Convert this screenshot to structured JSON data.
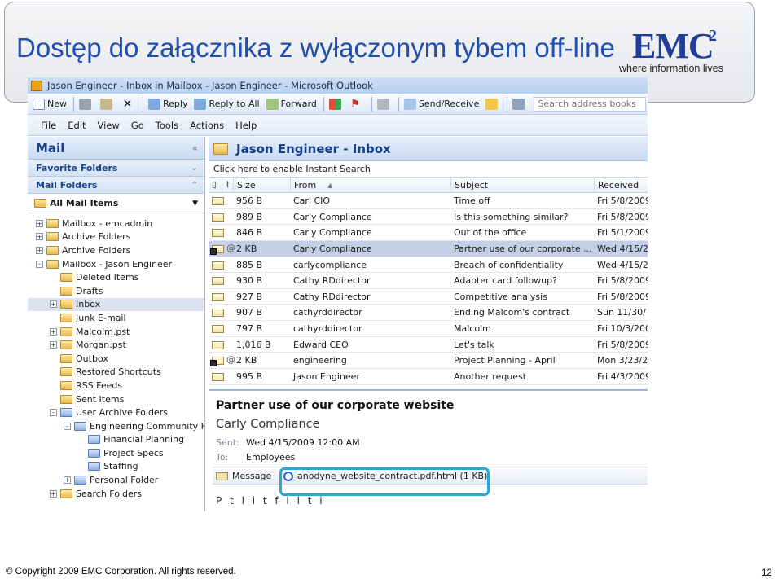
{
  "slide": {
    "title": "Dostęp do załącznika z wyłączonym tybem off-line",
    "logo_text": "EMC",
    "logo_sup": "2",
    "tagline": "where information lives",
    "copyright": "© Copyright 2009 EMC Corporation. All rights reserved.",
    "page_number": "12"
  },
  "window": {
    "title": "Jason Engineer - Inbox in Mailbox - Jason Engineer - Microsoft Outlook"
  },
  "toolbar": {
    "new": "New",
    "reply": "Reply",
    "reply_all": "Reply to All",
    "forward": "Forward",
    "send_receive": "Send/Receive",
    "search_placeholder": "Search address books"
  },
  "menu": [
    "File",
    "Edit",
    "View",
    "Go",
    "Tools",
    "Actions",
    "Help"
  ],
  "nav": {
    "title": "Mail",
    "favorite_folders": "Favorite Folders",
    "mail_folders": "Mail Folders",
    "all_mail_items": "All Mail Items",
    "tree": [
      {
        "label": "Mailbox - emcadmin",
        "indent": 0,
        "exp": "+",
        "icon": "mailbox"
      },
      {
        "label": "Archive Folders",
        "indent": 0,
        "exp": "+",
        "icon": "folder"
      },
      {
        "label": "Archive Folders",
        "indent": 0,
        "exp": "+",
        "icon": "folder"
      },
      {
        "label": "Mailbox - Jason Engineer",
        "indent": 0,
        "exp": "-",
        "icon": "mailbox"
      },
      {
        "label": "Deleted Items",
        "indent": 1,
        "exp": "",
        "icon": "folder"
      },
      {
        "label": "Drafts",
        "indent": 1,
        "exp": "",
        "icon": "folder"
      },
      {
        "label": "Inbox",
        "indent": 1,
        "exp": "+",
        "icon": "folder",
        "selected": true
      },
      {
        "label": "Junk E-mail",
        "indent": 1,
        "exp": "",
        "icon": "folder"
      },
      {
        "label": "Malcolm.pst",
        "indent": 1,
        "exp": "+",
        "icon": "folder"
      },
      {
        "label": "Morgan.pst",
        "indent": 1,
        "exp": "+",
        "icon": "folder"
      },
      {
        "label": "Outbox",
        "indent": 1,
        "exp": "",
        "icon": "folder"
      },
      {
        "label": "Restored Shortcuts",
        "indent": 1,
        "exp": "",
        "icon": "folder"
      },
      {
        "label": "RSS Feeds",
        "indent": 1,
        "exp": "",
        "icon": "folder"
      },
      {
        "label": "Sent Items",
        "indent": 1,
        "exp": "",
        "icon": "folder"
      },
      {
        "label": "User Archive Folders",
        "indent": 1,
        "exp": "-",
        "icon": "folder-blue"
      },
      {
        "label": "Engineering Community F",
        "indent": 2,
        "exp": "-",
        "icon": "folder-blue"
      },
      {
        "label": "Financial Planning",
        "indent": 3,
        "exp": "",
        "icon": "folder-blue"
      },
      {
        "label": "Project Specs",
        "indent": 3,
        "exp": "",
        "icon": "folder-blue"
      },
      {
        "label": "Staffing",
        "indent": 3,
        "exp": "",
        "icon": "folder-blue"
      },
      {
        "label": "Personal Folder",
        "indent": 2,
        "exp": "+",
        "icon": "folder-blue"
      },
      {
        "label": "Search Folders",
        "indent": 1,
        "exp": "+",
        "icon": "folder"
      }
    ]
  },
  "inbox": {
    "title": "Jason Engineer - Inbox",
    "instant_search": "Click here to enable Instant Search",
    "columns": {
      "size": "Size",
      "from": "From",
      "subject": "Subject",
      "received": "Received"
    },
    "rows": [
      {
        "size": "956 B",
        "from": "Carl CIO",
        "subject": "Time off",
        "received": "Fri 5/8/2009",
        "attach": false
      },
      {
        "size": "989 B",
        "from": "Carly Compliance",
        "subject": "Is this something similar?",
        "received": "Fri 5/8/2009",
        "attach": false
      },
      {
        "size": "846 B",
        "from": "Carly Compliance",
        "subject": "Out of the office",
        "received": "Fri 5/1/2009",
        "attach": false
      },
      {
        "size": "2 KB",
        "from": "Carly Compliance",
        "subject": "Partner use of our corporate ...",
        "received": "Wed 4/15/2",
        "attach": true,
        "selected": true
      },
      {
        "size": "885 B",
        "from": "carlycompliance",
        "subject": "Breach of confidentiality",
        "received": "Wed 4/15/2",
        "attach": false
      },
      {
        "size": "930 B",
        "from": "Cathy RDdirector",
        "subject": "Adapter card followup?",
        "received": "Fri 5/8/2009",
        "attach": false
      },
      {
        "size": "927 B",
        "from": "Cathy RDdirector",
        "subject": "Competitive analysis",
        "received": "Fri 5/8/2009",
        "attach": false
      },
      {
        "size": "907 B",
        "from": "cathyrddirector",
        "subject": "Ending Malcom's contract",
        "received": "Sun 11/30/",
        "attach": false
      },
      {
        "size": "797 B",
        "from": "cathyrddirector",
        "subject": "Malcolm",
        "received": "Fri 10/3/200",
        "attach": false
      },
      {
        "size": "1,016 B",
        "from": "Edward CEO",
        "subject": "Let's talk",
        "received": "Fri 5/8/2009",
        "attach": false
      },
      {
        "size": "2 KB",
        "from": "engineering",
        "subject": "Project Planning - April",
        "received": "Mon 3/23/2",
        "attach": true
      },
      {
        "size": "995 B",
        "from": "Jason Engineer",
        "subject": "Another request",
        "received": "Fri 4/3/2009",
        "attach": false
      }
    ]
  },
  "reading_pane": {
    "subject": "Partner use of our corporate website",
    "from": "Carly Compliance",
    "sent_label": "Sent:",
    "sent_value": "Wed 4/15/2009 12:00 AM",
    "to_label": "To:",
    "to_value": "Employees",
    "message_tab": "Message",
    "attachment": "anodyne_website_contract.pdf.html (1 KB)",
    "body_partial": "P  t  l  i  t  f  l  l  t  i"
  },
  "colors": {
    "title_blue": "#1f4fb0",
    "emc_blue": "#1f3d99",
    "highlight": "#27a6d8",
    "selection": "#c2cfe6"
  }
}
